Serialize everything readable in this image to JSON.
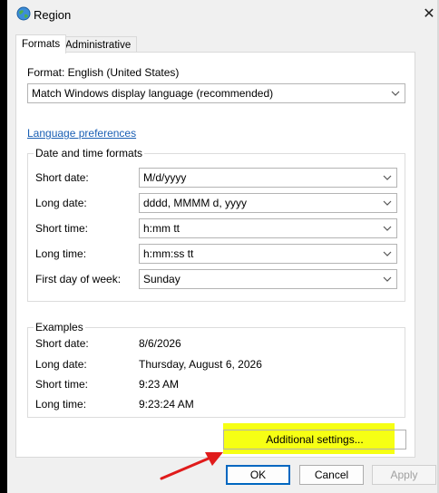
{
  "window": {
    "title": "Region",
    "close_symbol": "✕"
  },
  "tabs": [
    {
      "label": "Formats",
      "active": true
    },
    {
      "label": "Administrative",
      "active": false
    }
  ],
  "format": {
    "label": "Format: English (United States)",
    "value": "Match Windows display language (recommended)"
  },
  "language_preferences_link": "Language preferences",
  "date_time_formats": {
    "title": "Date and time formats",
    "rows": [
      {
        "label": "Short date:",
        "value": "M/d/yyyy"
      },
      {
        "label": "Long date:",
        "value": "dddd, MMMM d, yyyy"
      },
      {
        "label": "Short time:",
        "value": "h:mm tt"
      },
      {
        "label": "Long time:",
        "value": "h:mm:ss tt"
      },
      {
        "label": "First day of week:",
        "value": "Sunday"
      }
    ]
  },
  "examples": {
    "title": "Examples",
    "rows": [
      {
        "label": "Short date:",
        "value": "8/6/2026"
      },
      {
        "label": "Long date:",
        "value": "Thursday, August 6, 2026"
      },
      {
        "label": "Short time:",
        "value": "9:23 AM"
      },
      {
        "label": "Long time:",
        "value": "9:23:24 AM"
      }
    ]
  },
  "buttons": {
    "additional_settings": "Additional settings...",
    "ok": "OK",
    "cancel": "Cancel",
    "apply": "Apply"
  },
  "colors": {
    "highlight": "#f5ff00",
    "arrow": "#e01b1b",
    "link": "#1a5fb4",
    "ok_border": "#0067c0"
  },
  "icons": {
    "title": "globe-icon",
    "dropdown": "chevron-down-icon",
    "arrow": "red-arrow-annotation"
  }
}
